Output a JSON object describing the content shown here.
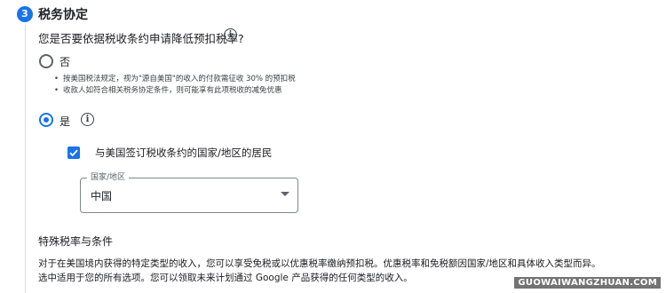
{
  "step": {
    "number": "3",
    "title": "税务协定"
  },
  "question": "您是否要依据税收条约申请降低预扣税率?",
  "options": {
    "no": {
      "label": "否",
      "bullets": [
        "按美国税法规定，视为\"源自美国\"的收入的付款需征收 30% 的预扣税",
        "收款人如符合相关税务协定条件，则可能享有此项税收的减免优惠"
      ],
      "selected": false
    },
    "yes": {
      "label": "是",
      "selected": true
    }
  },
  "resident_checkbox": {
    "label": "与美国签订税收条约的国家/地区的居民",
    "checked": true
  },
  "country_select": {
    "label": "国家/地区",
    "value": "中国"
  },
  "special": {
    "heading": "特殊税率与条件",
    "lines": [
      "对于在美国境内获得的特定类型的收入，您可以享受免税或以优惠税率缴纳预扣税。优惠税率和免税额因国家/地区和具体收入类型而异。",
      "选中适用于您的所有选项。您可以领取未来计划通过 Google 产品获得的任何类型的收入。"
    ]
  },
  "watermark": "GUOWAIWANGZHUAN.COM",
  "colors": {
    "accent": "#1a73e8",
    "rail": "#dadce0"
  }
}
